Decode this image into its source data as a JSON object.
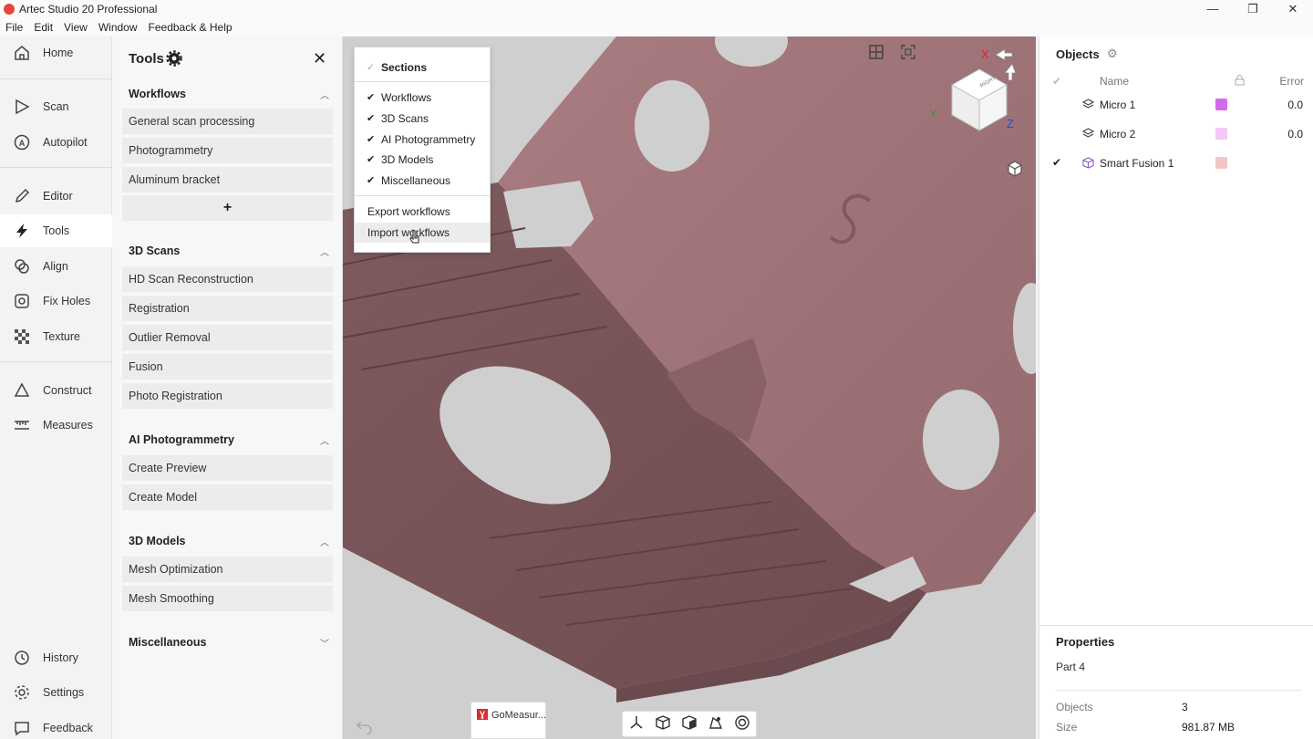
{
  "window": {
    "title": "Artec Studio 20 Professional",
    "controls": [
      "—",
      "❐",
      "✕"
    ]
  },
  "menubar": [
    "File",
    "Edit",
    "View",
    "Window",
    "Feedback & Help"
  ],
  "leftnav": {
    "top_items": [
      {
        "label": "Home",
        "icon": "home-icon"
      },
      {
        "label": "Scan",
        "icon": "play-icon"
      },
      {
        "label": "Autopilot",
        "icon": "autopilot-icon"
      },
      {
        "label": "Editor",
        "icon": "pencil-icon"
      },
      {
        "label": "Tools",
        "icon": "lightning-icon",
        "active": true
      },
      {
        "label": "Align",
        "icon": "align-icon"
      },
      {
        "label": "Fix Holes",
        "icon": "fix-holes-icon"
      },
      {
        "label": "Texture",
        "icon": "texture-icon"
      },
      {
        "label": "Construct",
        "icon": "triangle-icon"
      },
      {
        "label": "Measures",
        "icon": "ruler-icon"
      }
    ],
    "bottom_items": [
      {
        "label": "History",
        "icon": "history-icon"
      },
      {
        "label": "Settings",
        "icon": "gear-icon"
      },
      {
        "label": "Feedback",
        "icon": "chat-icon"
      }
    ]
  },
  "tools_panel": {
    "title": "Tools",
    "sections": [
      {
        "name": "Workflows",
        "expanded": true,
        "items": [
          "General scan processing",
          "Photogrammetry",
          "Aluminum bracket"
        ],
        "add_label": "+"
      },
      {
        "name": "3D Scans",
        "expanded": true,
        "items": [
          "HD Scan Reconstruction",
          "Registration",
          "Outlier Removal",
          "Fusion",
          "Photo Registration"
        ]
      },
      {
        "name": "AI Photogrammetry",
        "expanded": true,
        "items": [
          "Create Preview",
          "Create Model"
        ]
      },
      {
        "name": "3D Models",
        "expanded": true,
        "items": [
          "Mesh Optimization",
          "Mesh Smoothing"
        ]
      },
      {
        "name": "Miscellaneous",
        "expanded": false,
        "items": []
      }
    ]
  },
  "popup_menu": {
    "header": "Sections",
    "checked_items": [
      "Workflows",
      "3D Scans",
      "AI Photogrammetry",
      "3D Models",
      "Miscellaneous"
    ],
    "actions": [
      "Export workflows",
      "Import workflows"
    ],
    "hovered": "Import workflows"
  },
  "taskbar_thumb": {
    "label": "GoMeasur...",
    "icon_letter": "Ɣ"
  },
  "viewcube": {
    "face": "RIGHT",
    "axes": [
      "X",
      "Y",
      "Z"
    ]
  },
  "objects_panel": {
    "title": "Objects",
    "columns": {
      "name": "Name",
      "error": "Error"
    },
    "rows": [
      {
        "name": "Micro 1",
        "color": "#d46be8",
        "error": "0.0",
        "checked": false,
        "icon": "layers-icon"
      },
      {
        "name": "Micro 2",
        "color": "#f6c8f4",
        "error": "0.0",
        "checked": false,
        "icon": "layers-icon"
      },
      {
        "name": "Smart Fusion 1",
        "color": "#f5c4c4",
        "error": "",
        "checked": true,
        "icon": "cube-icon"
      }
    ]
  },
  "properties": {
    "title": "Properties",
    "part_name": "Part 4",
    "rows": [
      {
        "key": "Objects",
        "value": "3"
      },
      {
        "key": "Size",
        "value": "981.87 MB"
      }
    ]
  },
  "colors": {
    "mesh": "#9a6e72",
    "mesh_dark": "#7a5458",
    "viewport_bg": "#cfcfcf",
    "accent_red": "#e2483c"
  }
}
